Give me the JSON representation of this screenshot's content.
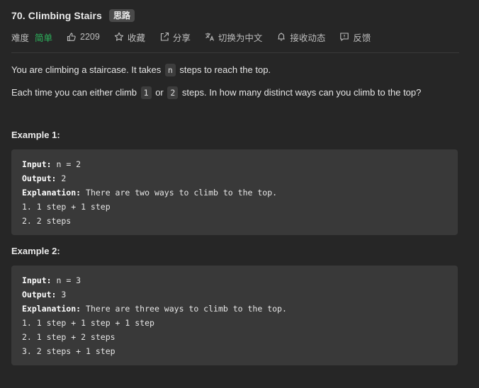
{
  "problem": {
    "title": "70. Climbing Stairs",
    "tag": "思路"
  },
  "meta": {
    "difficulty_label": "难度",
    "difficulty_value": "简单",
    "difficulty_color": "#2db55d",
    "likes": "2209",
    "favorite": "收藏",
    "share": "分享",
    "translate": "切换为中文",
    "subscribe": "接收动态",
    "feedback": "反馈",
    "icons": {
      "likes": "thumbs-up-icon",
      "favorite": "star-icon",
      "share": "share-icon",
      "translate": "translate-icon",
      "subscribe": "bell-icon",
      "feedback": "feedback-icon"
    }
  },
  "description": {
    "p1_before": "You are climbing a staircase. It takes ",
    "p1_code": "n",
    "p1_after": " steps to reach the top.",
    "p2_before": "Each time you can either climb ",
    "p2_code1": "1",
    "p2_mid": " or ",
    "p2_code2": "2",
    "p2_after": " steps. In how many distinct ways can you climb to the top?"
  },
  "examples": [
    {
      "title": "Example 1:",
      "input_label": "Input:",
      "input_value": " n = 2",
      "output_label": "Output:",
      "output_value": " 2",
      "explanation_label": "Explanation:",
      "explanation_value": " There are two ways to climb to the top.",
      "lines": [
        "1. 1 step + 1 step",
        "2. 2 steps"
      ]
    },
    {
      "title": "Example 2:",
      "input_label": "Input:",
      "input_value": " n = 3",
      "output_label": "Output:",
      "output_value": " 3",
      "explanation_label": "Explanation:",
      "explanation_value": " There are three ways to climb to the top.",
      "lines": [
        "1. 1 step + 1 step + 1 step",
        "2. 1 step + 2 steps",
        "3. 2 steps + 1 step"
      ]
    }
  ]
}
